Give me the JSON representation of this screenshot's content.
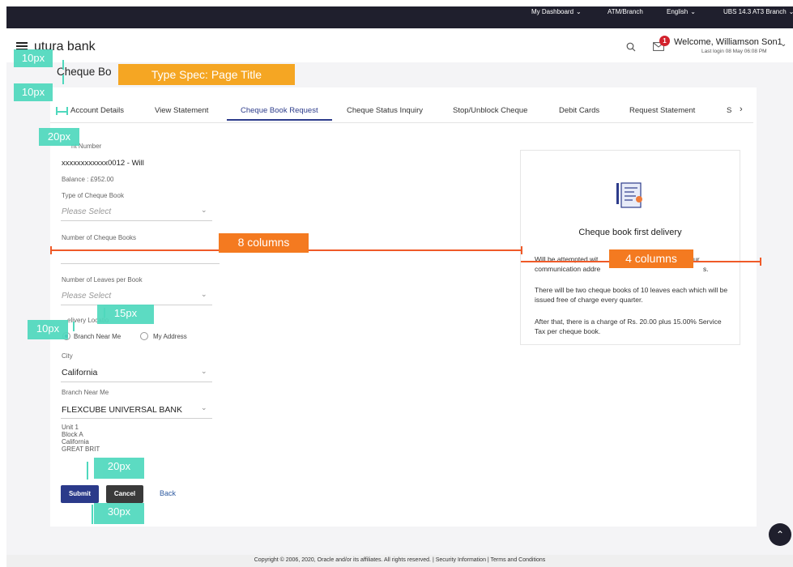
{
  "topbar": {
    "dashboard": "My Dashboard",
    "atm_branch": "ATM/Branch",
    "language": "English",
    "branch": "UBS 14.3 AT3 Branch"
  },
  "header": {
    "logo": "utura bank",
    "welcome": "Welcome, Williamson Son1",
    "last_login": "Last login 08 May 06:08 PM",
    "notification_count": "1"
  },
  "page": {
    "title": "Cheque Bo"
  },
  "tabs": [
    {
      "label": "Account Details"
    },
    {
      "label": "View Statement"
    },
    {
      "label": "Cheque Book Request"
    },
    {
      "label": "Cheque Status Inquiry"
    },
    {
      "label": "Stop/Unblock Cheque"
    },
    {
      "label": "Debit Cards"
    },
    {
      "label": "Request Statement"
    },
    {
      "label": "S"
    }
  ],
  "active_tab": "Cheque Book Request",
  "form": {
    "account_label": "nt Number",
    "account_value": "xxxxxxxxxxxx0012 - Will",
    "balance": "Balance : £952.00",
    "cheque_type_label": "Type of Cheque Book",
    "cheque_type_placeholder": "Please Select",
    "num_books_label": "Number of Cheque Books",
    "num_leaves_label": "Number of Leaves per Book",
    "num_leaves_placeholder": "Please Select",
    "delivery_label": "elivery Locatio",
    "delivery_options": [
      "Branch Near Me",
      "My Address"
    ],
    "city_label": "City",
    "city_value": "California",
    "branch_label": "Branch Near Me",
    "branch_value": "FLEXCUBE UNIVERSAL BANK",
    "address_lines": [
      "Unit 1",
      "Block A",
      "California",
      "GREAT BRIT"
    ],
    "submit": "Submit",
    "cancel": "Cancel",
    "back": "Back"
  },
  "info_panel": {
    "title": "Cheque book first delivery",
    "line1a": "Will be attempted wit",
    "line1b": "ur",
    "line2": "communication addre",
    "line2b": "s.",
    "para2": "There will be two cheque books of 10 leaves each which will be issued free of charge every quarter.",
    "para3": "After that, there is a charge of Rs. 20.00 plus 15.00% Service Tax per cheque book."
  },
  "annotations": {
    "page_title_spec": "Type Spec: Page Title",
    "eight_columns": "8 columns",
    "four_columns": "4 columns",
    "px10a": "10px",
    "px10b": "10px",
    "px20a": "20px",
    "px15": "15px",
    "px10c": "10px",
    "px20b": "20px",
    "px30": "30px"
  },
  "footer": {
    "copyright": "Copyright © 2006, 2020, Oracle and/or its affiliates. All rights reserved. | Security Information | Terms and Conditions"
  }
}
